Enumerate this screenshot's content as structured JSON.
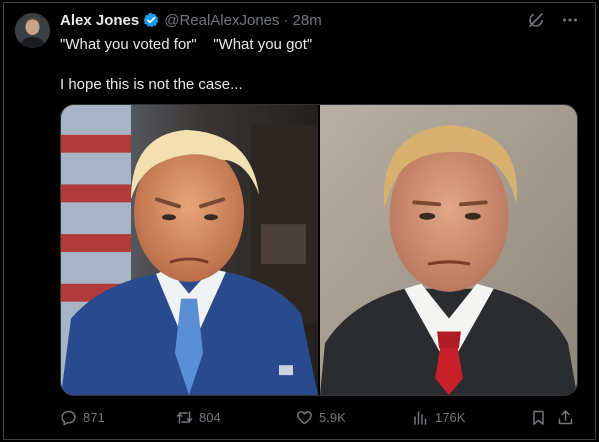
{
  "tweet": {
    "author_name": "Alex Jones",
    "handle": "@RealAlexJones",
    "separator": "·",
    "time": "28m",
    "text_line1": "\"What you voted for\"    \"What you got\"",
    "text_line2": "I hope this is not the case..."
  },
  "stats": {
    "replies": "871",
    "retweets": "804",
    "likes": "5.9K",
    "views": "176K"
  },
  "colors": {
    "background": "#000000",
    "text_primary": "#e7e9ea",
    "text_secondary": "#71767b",
    "verified": "#1d9bf0",
    "border": "#2f3336"
  },
  "icons": {
    "verified": "verified-badge-icon",
    "grok": "grok-icon",
    "more": "more-icon",
    "reply": "reply-icon",
    "retweet": "retweet-icon",
    "like": "heart-icon",
    "views": "views-icon",
    "bookmark": "bookmark-icon",
    "share": "share-icon"
  }
}
